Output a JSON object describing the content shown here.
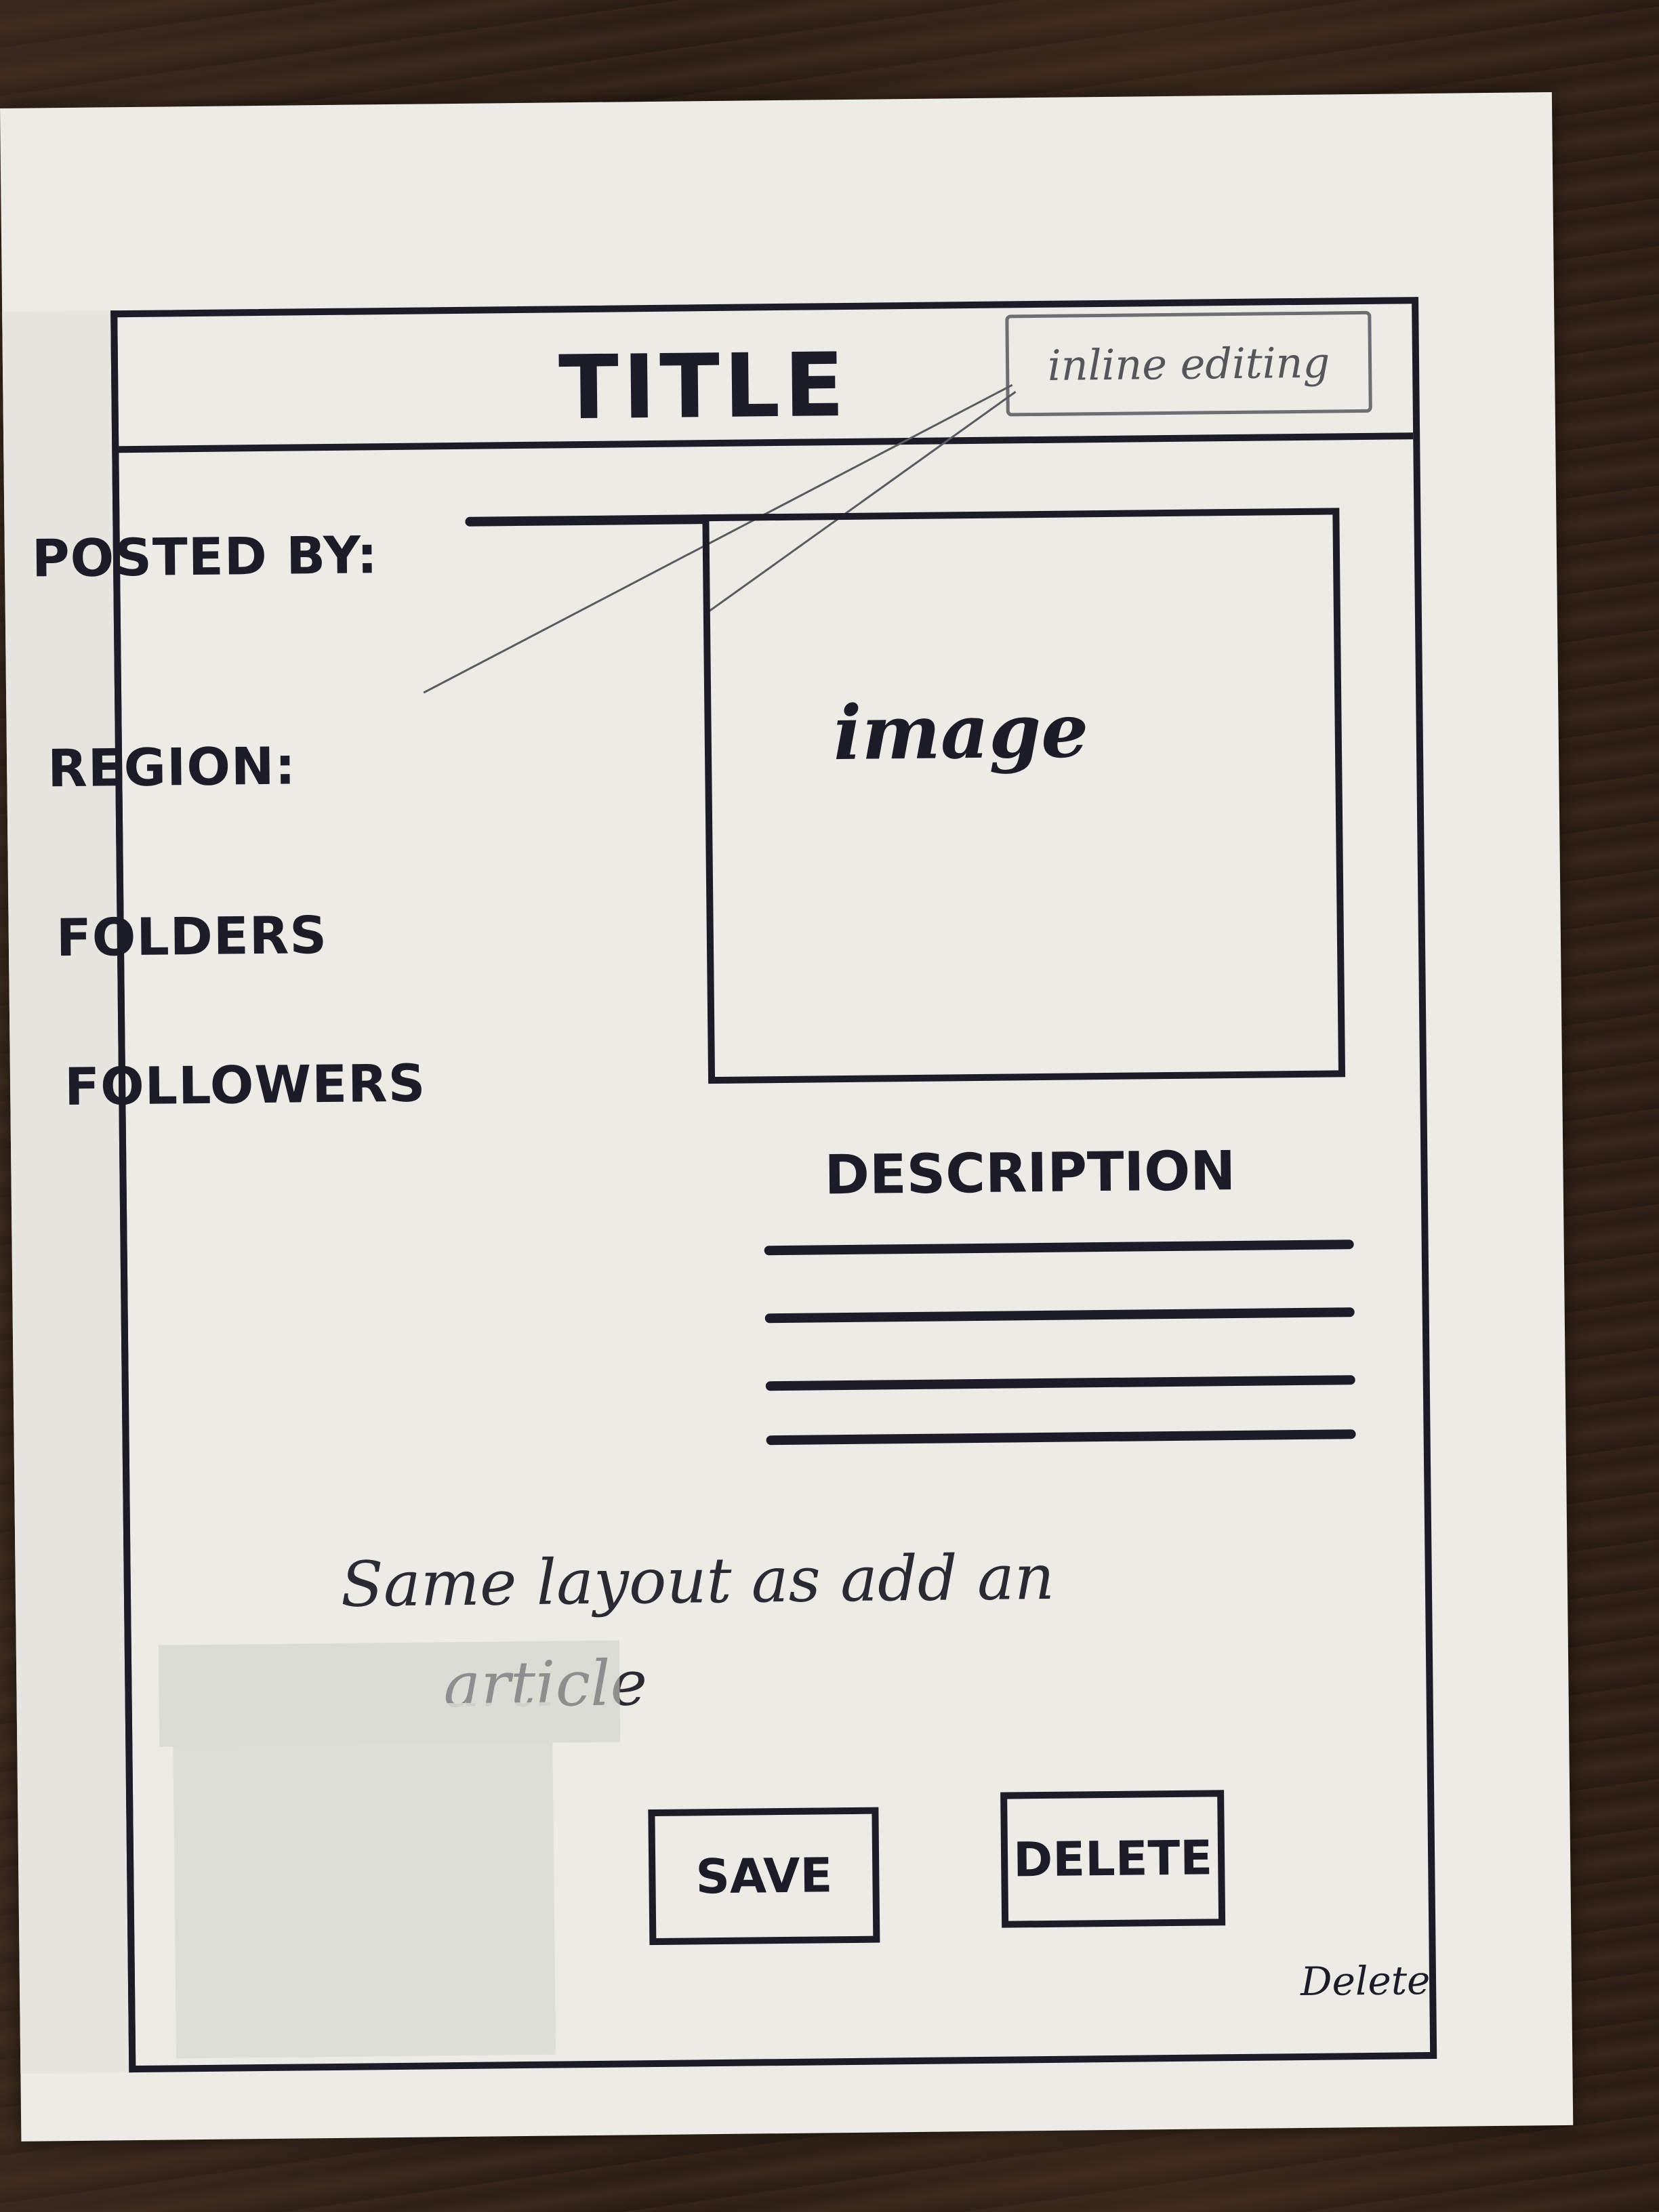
{
  "header": {
    "title": "TITLE",
    "annotation": "inline editing"
  },
  "fields": {
    "posted_by": "POSTED BY:",
    "region": "REGION:",
    "folders": "FOLDERS",
    "followers": "FOLLOWERS"
  },
  "image_placeholder": "image",
  "description": {
    "title": "DESCRIPTION",
    "line_count": 4
  },
  "note": {
    "line1": "Same layout as add an",
    "line2": "article"
  },
  "actions": {
    "save_label": "SAVE",
    "delete_label": "DELETE",
    "small_delete": "Delete"
  }
}
